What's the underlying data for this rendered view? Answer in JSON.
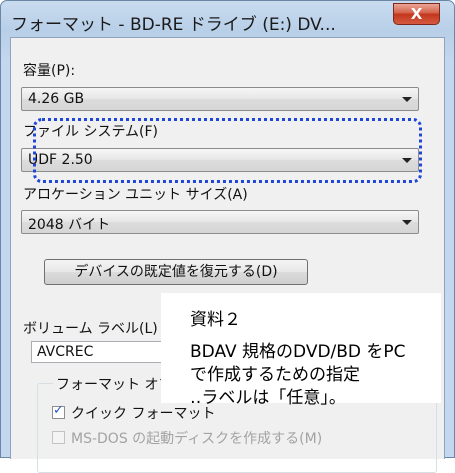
{
  "window": {
    "title": "フォーマット - BD-RE ドライブ (E:) DV...",
    "close_label": "X"
  },
  "capacity": {
    "label": "容量(P):",
    "value": "4.26 GB"
  },
  "file_system": {
    "label": "ファイル システム(F)",
    "value": "UDF 2.50"
  },
  "allocation_unit": {
    "label": "アロケーション ユニット サイズ(A)",
    "value": "2048 バイト"
  },
  "restore_defaults_button": "デバイスの既定値を復元する(D)",
  "volume_label": {
    "label": "ボリューム ラベル(L)",
    "value": "AVCREC"
  },
  "format_options": {
    "title": "フォーマット オプション",
    "quick_format": {
      "label": "クイック フォーマット",
      "checked": true
    },
    "msdos_boot": {
      "label": "MS-DOS の起動ディスクを作成する(M)",
      "checked": false,
      "disabled": true
    }
  },
  "annotation": {
    "title": "資料２",
    "lines": [
      "BDAV 規格のDVD/BD をPC",
      "で作成するための指定",
      "‥ラベルは「任意」。"
    ]
  },
  "colors": {
    "highlight": "#1f46d6",
    "close_button": "#c2361c"
  }
}
